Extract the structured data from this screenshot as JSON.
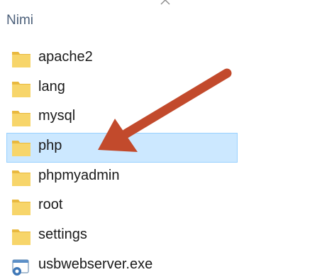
{
  "column_header": {
    "label": "Nimi"
  },
  "items": [
    {
      "label": "apache2",
      "type": "folder",
      "selected": false
    },
    {
      "label": "lang",
      "type": "folder",
      "selected": false
    },
    {
      "label": "mysql",
      "type": "folder",
      "selected": false
    },
    {
      "label": "php",
      "type": "folder",
      "selected": true
    },
    {
      "label": "phpmyadmin",
      "type": "folder",
      "selected": false
    },
    {
      "label": "root",
      "type": "folder",
      "selected": false
    },
    {
      "label": "settings",
      "type": "folder",
      "selected": false
    },
    {
      "label": "usbwebserver.exe",
      "type": "exe",
      "selected": false
    }
  ],
  "colors": {
    "header_text": "#4c607a",
    "selection_fill": "#cce8ff",
    "selection_border": "#99d1ff",
    "folder_yellow": "#f7d56a",
    "arrow": "#c24a2c"
  },
  "icons": {
    "folder": "folder-icon",
    "exe": "exe-icon",
    "sort": "chevron-up-icon"
  }
}
